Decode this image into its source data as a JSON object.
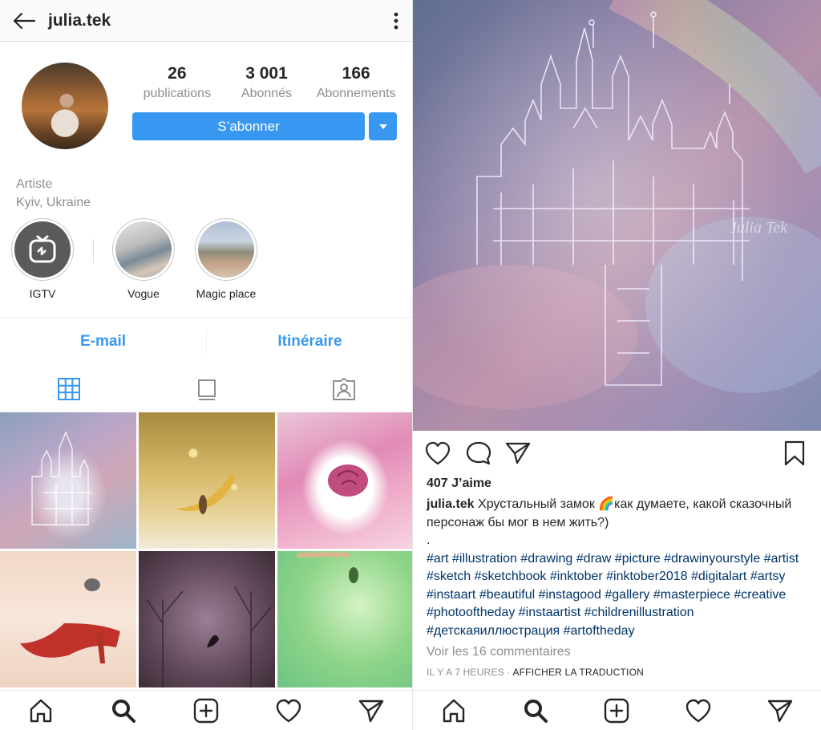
{
  "profile": {
    "username": "julia.tek",
    "stats": [
      {
        "value": "26",
        "label": "publications"
      },
      {
        "value": "3 001",
        "label": "Abonnés"
      },
      {
        "value": "166",
        "label": "Abonnements"
      }
    ],
    "follow_label": "S’abonner",
    "bio": {
      "category": "Artiste",
      "location": "Kyiv, Ukraine"
    },
    "highlights": [
      {
        "label": "IGTV",
        "icon": "igtv-icon"
      },
      {
        "label": "Vogue"
      },
      {
        "label": "Magic place"
      }
    ],
    "contact": {
      "email_label": "E-mail",
      "directions_label": "Itinéraire"
    },
    "tabs": [
      "grid-icon",
      "feed-icon",
      "tagged-icon"
    ]
  },
  "post": {
    "watermark": "Julia Tek",
    "likes": "407 J’aime",
    "username": "julia.tek",
    "caption_text": "Хрустальный замок 🌈как думаете, какой сказочный персонаж бы мог в нем жить?)",
    "caption_dot": ".",
    "hashtags": "#art #illustration #drawing #draw #picture #drawinyourstyle #artist #sketch #sketchbook #inktober #inktober2018 #digitalart #artsy #instaart #beautiful #instagood #gallery #masterpiece #creative #photooftheday #instaartist #childrenillustration #детскаяиллюстрация #artoftheday",
    "view_comments": "Voir les 16 commentaires",
    "time": "IL Y A 7 HEURES",
    "separator": " · ",
    "translate": "AFFICHER LA TRADUCTION"
  },
  "colors": {
    "accent": "#3897f0",
    "hashtag": "#003569",
    "muted": "#8e8e8e"
  }
}
